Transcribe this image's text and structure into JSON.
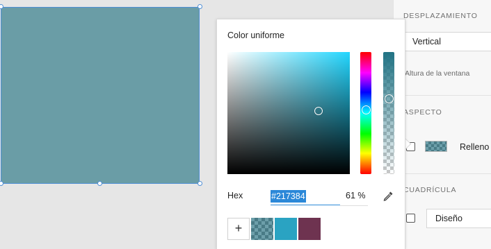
{
  "panel": {
    "scroll_section_title": "DESPLAZAMIENTO",
    "scroll_value": "Vertical",
    "viewport_label": "Altura de la ventana",
    "appearance_section_title": "ASPECTO",
    "fill_label": "Relleno",
    "grid_section_title": "CUADRÍCULA",
    "grid_value": "Diseño"
  },
  "color_picker": {
    "title": "Color uniforme",
    "hex_label": "Hex",
    "hex_value": "#217384",
    "opacity": "61 %",
    "add_swatch_label": "+",
    "swatches": [
      {
        "color": "#217384",
        "opacity": 0.61
      },
      {
        "color": "#2aa3c2",
        "opacity": 1
      },
      {
        "color": "#6e3350",
        "opacity": 1
      }
    ]
  },
  "colors": {
    "shape_fill": "#6a9da6",
    "selection": "#4f8fd6",
    "accent": "#2b88d8"
  }
}
